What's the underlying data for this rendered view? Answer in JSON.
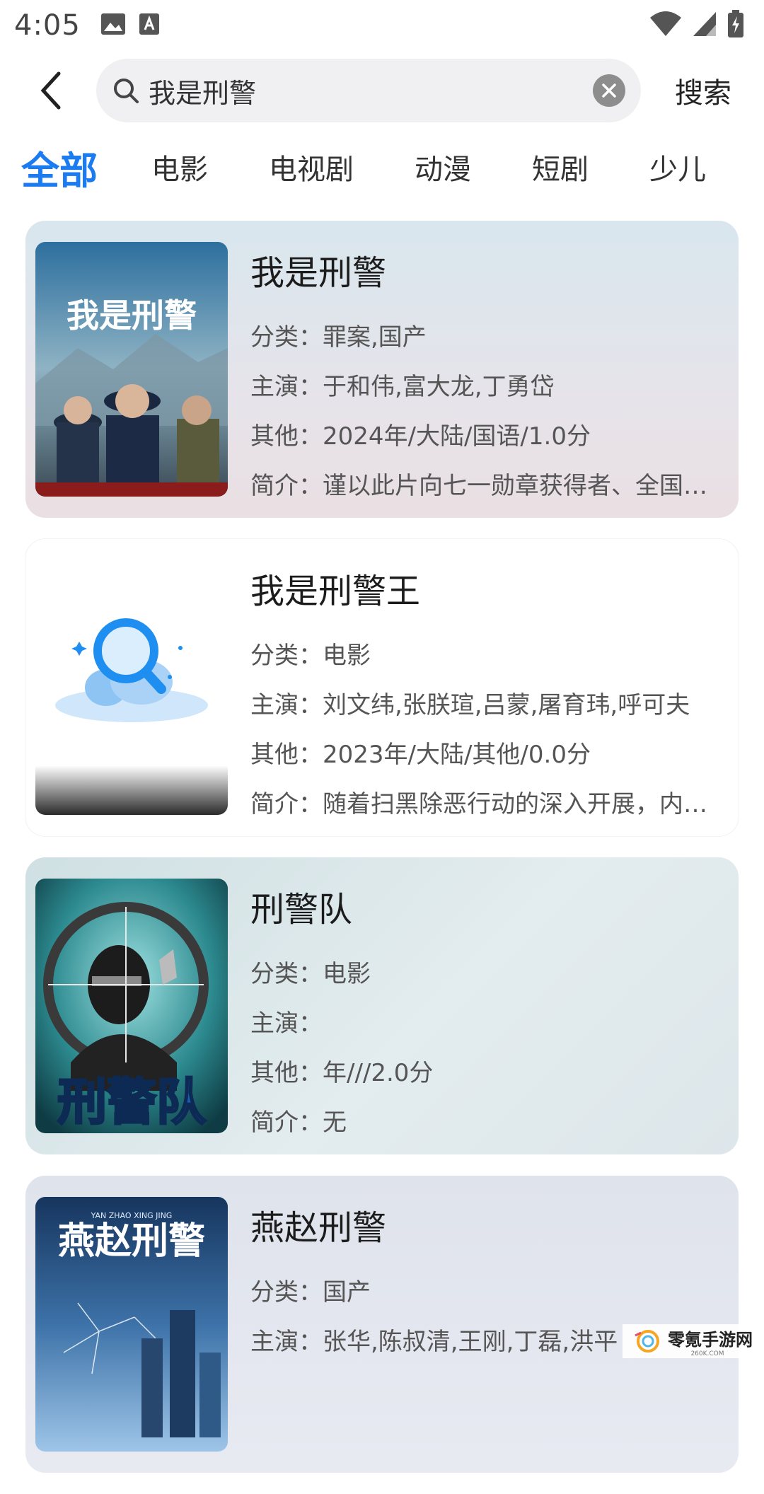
{
  "status_bar": {
    "time": "4:05"
  },
  "search": {
    "query": "我是刑警",
    "search_label": "搜索"
  },
  "tabs": [
    "全部",
    "电影",
    "电视剧",
    "动漫",
    "短剧",
    "少儿"
  ],
  "results": [
    {
      "title": "我是刑警",
      "category_label": "分类：",
      "category": "罪案,国产",
      "cast_label": "主演：",
      "cast": "于和伟,富大龙,丁勇岱",
      "other_label": "其他：",
      "other": "2024年/大陆/国语/1.0分",
      "summary_label": "简介：",
      "summary": "谨以此片向七一勋章获得者、全国…",
      "poster_text": "我是刑警"
    },
    {
      "title": "我是刑警王",
      "category_label": "分类：",
      "category": "电影",
      "cast_label": "主演：",
      "cast": "刘文纬,张朕瑄,吕蒙,屠育玮,呼可夫",
      "other_label": "其他：",
      "other": "2023年/大陆/其他/0.0分",
      "summary_label": "简介：",
      "summary": "随着扫黑除恶行动的深入开展，内…"
    },
    {
      "title": "刑警队",
      "category_label": "分类：",
      "category": "电影",
      "cast_label": "主演：",
      "cast": "",
      "other_label": "其他：",
      "other": "年///2.0分",
      "summary_label": "简介：",
      "summary": "无",
      "poster_text": "刑警队"
    },
    {
      "title": "燕赵刑警",
      "category_label": "分类：",
      "category": "国产",
      "cast_label": "主演：",
      "cast": "张华,陈叔清,王刚,丁磊,洪平",
      "poster_text": "燕赵刑警",
      "poster_subtext": "YAN ZHAO XING JING"
    }
  ],
  "watermark": {
    "text": "零氪手游网",
    "subtext": "260K.COM"
  },
  "colors": {
    "accent": "#1a7cf0"
  }
}
